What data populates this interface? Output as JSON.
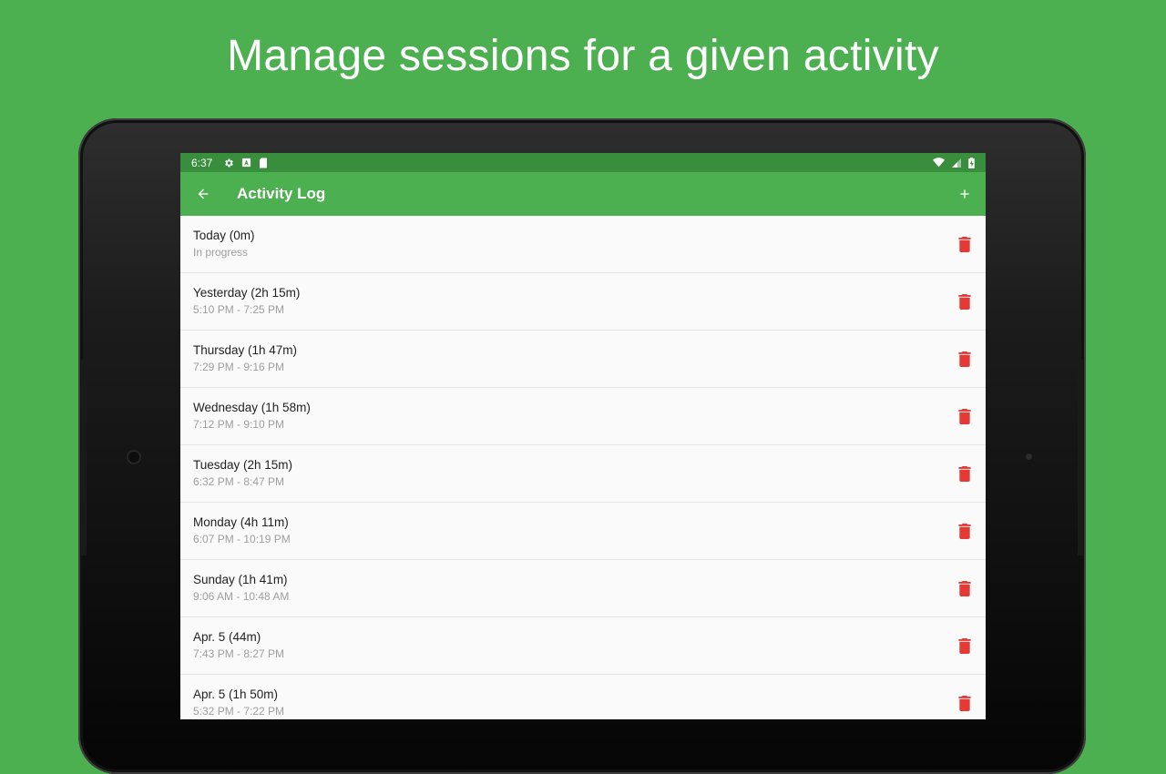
{
  "headline": "Manage sessions for a given activity",
  "colors": {
    "background": "#4caf50",
    "app_bar": "#4caf50",
    "status_bar": "#388e3c",
    "delete_icon": "#e53935"
  },
  "status_bar": {
    "time": "6:37",
    "left_icons": [
      "settings-icon",
      "keyboard-a-icon",
      "sd-card-icon"
    ],
    "right_icons": [
      "wifi-icon",
      "signal-icon",
      "battery-icon"
    ]
  },
  "app_bar": {
    "title": "Activity Log",
    "back_icon": "arrow-back-icon",
    "add_icon": "plus-icon"
  },
  "sessions": [
    {
      "title": "Today (0m)",
      "subtitle": "In progress"
    },
    {
      "title": "Yesterday (2h 15m)",
      "subtitle": "5:10 PM - 7:25 PM"
    },
    {
      "title": "Thursday (1h 47m)",
      "subtitle": "7:29 PM - 9:16 PM"
    },
    {
      "title": "Wednesday (1h 58m)",
      "subtitle": "7:12 PM - 9:10 PM"
    },
    {
      "title": "Tuesday (2h 15m)",
      "subtitle": "6:32 PM - 8:47 PM"
    },
    {
      "title": "Monday (4h 11m)",
      "subtitle": "6:07 PM - 10:19 PM"
    },
    {
      "title": "Sunday (1h 41m)",
      "subtitle": "9:06 AM - 10:48 AM"
    },
    {
      "title": "Apr. 5 (44m)",
      "subtitle": "7:43 PM - 8:27 PM"
    },
    {
      "title": "Apr. 5 (1h 50m)",
      "subtitle": "5:32 PM - 7:22 PM"
    }
  ]
}
